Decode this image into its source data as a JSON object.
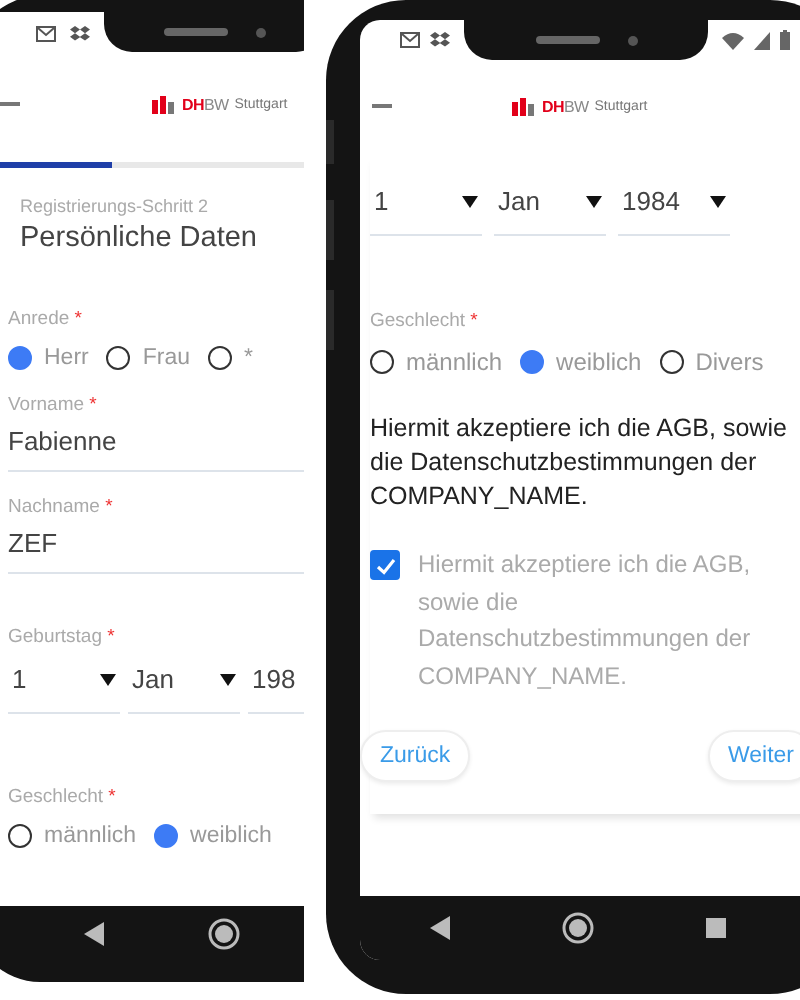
{
  "phones": [
    {
      "logo": {
        "mark": "DH",
        "rest": "BW",
        "city": "Stuttgart"
      },
      "progress": {
        "level": 0.27
      },
      "step": "Registrierungs-Schritt 2",
      "heading": "Persönliche Daten",
      "fields": [
        {
          "kind": "radio",
          "label": "Anrede",
          "required": "*",
          "options": [
            {
              "label": "Herr",
              "selected": true
            },
            {
              "label": "Frau",
              "selected": false
            },
            {
              "label": "*",
              "selected": false
            }
          ]
        },
        {
          "kind": "text",
          "label": "Vorname",
          "required": "*",
          "value": "Fabienne"
        },
        {
          "kind": "text",
          "label": "Nachname",
          "required": "*",
          "value": "ZEF"
        },
        {
          "kind": "date",
          "label": "Geburtstag",
          "required": "*",
          "selects": [
            {
              "value": "1",
              "arrow": true
            },
            {
              "value": "Jan",
              "arrow": true
            },
            {
              "value": "198",
              "arrow": false
            }
          ]
        },
        {
          "kind": "radio",
          "label": "Geschlecht",
          "required": "*",
          "options": [
            {
              "label": "männlich",
              "selected": false
            },
            {
              "label": "weiblich",
              "selected": true
            }
          ]
        }
      ],
      "nav_recent": false
    },
    {
      "logo": {
        "mark": "DH",
        "rest": "BW",
        "city": "Stuttgart"
      },
      "fields": [
        {
          "kind": "date",
          "selects": [
            {
              "value": "1",
              "arrow": true
            },
            {
              "value": "Jan",
              "arrow": true
            },
            {
              "value": "1984",
              "arrow": true
            }
          ]
        },
        {
          "kind": "radio",
          "label": "Geschlecht",
          "required": "*",
          "options": [
            {
              "label": "männlich",
              "selected": false
            },
            {
              "label": "weiblich",
              "selected": true
            },
            {
              "label": "Divers",
              "selected": false
            }
          ]
        },
        {
          "kind": "paragraph",
          "text": "Hiermit akzeptiere ich die AGB, sowie die Datenschutzbestimmungen der COMPANY_NAME."
        },
        {
          "kind": "checkbox",
          "checked": true,
          "label": "Hiermit akzeptiere ich die AGB, sowie die Datenschutzbestimmungen der COMPANY_NAME."
        },
        {
          "kind": "buttons",
          "buttons": [
            {
              "label": "Zurück"
            },
            {
              "label": "Weiter"
            }
          ]
        }
      ],
      "nav_recent": true
    }
  ]
}
